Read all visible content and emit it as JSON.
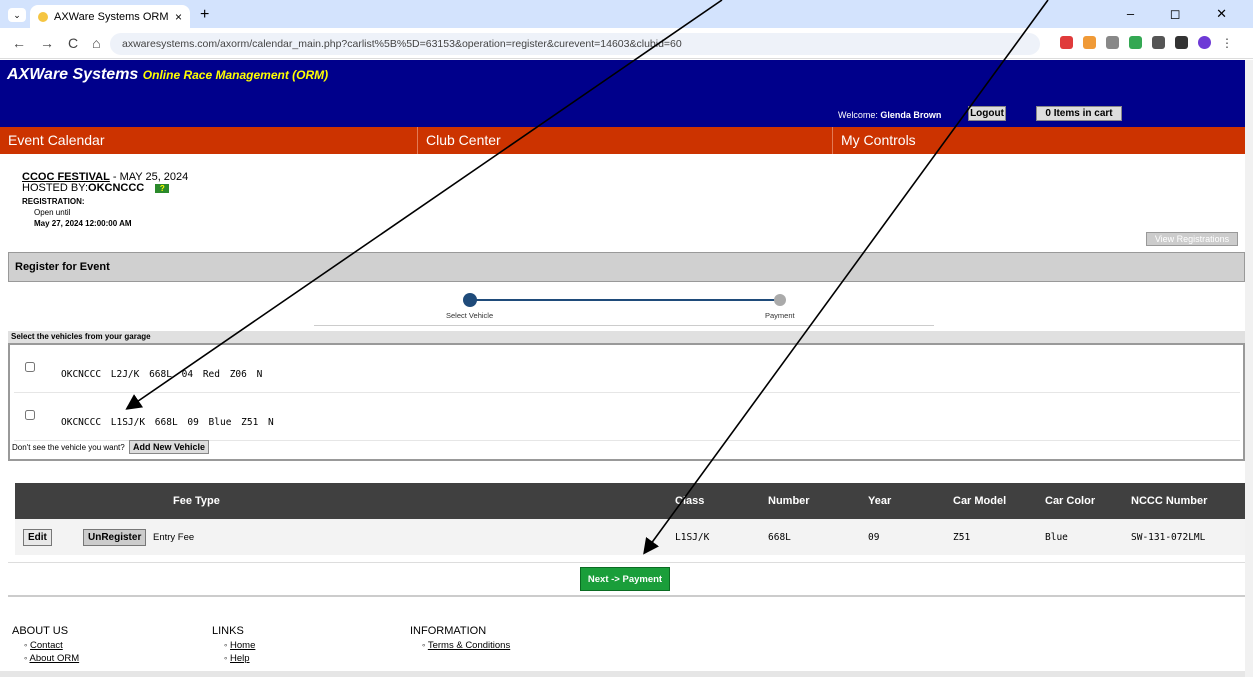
{
  "browser": {
    "tab_title": "AXWare Systems ORM",
    "new_tab": "+",
    "tab_close": "×",
    "tab_menu": "⌄",
    "window_controls": "–  ◻  ✕",
    "back": "←",
    "forward": "→",
    "reload": "C",
    "home": "⌂",
    "url": "axwaresystems.com/axorm/calendar_main.php?carlist%5B%5D=63153&operation=register&curevent=14603&clubid=60"
  },
  "header": {
    "brand": "AXWare Systems",
    "brand_sub": "Online Race Management (ORM)",
    "welcome_prefix": "Welcome:",
    "user_name": "Glenda Brown",
    "logout": "Logout",
    "cart": "0 Items in cart"
  },
  "menu": {
    "event_calendar": "Event Calendar",
    "club_center": "Club Center",
    "my_controls": "My Controls"
  },
  "event": {
    "name": "CCOC FESTIVAL",
    "date": "- MAY 25, 2024",
    "hosted_by_label": "HOSTED BY:",
    "host": "OKCNCCC",
    "help_badge": "?",
    "registration_label": "REGISTRATION:",
    "open_until_label": "Open until",
    "open_until": "May 27, 2024 12:00:00 AM",
    "view_registrations": "View Registrations"
  },
  "register": {
    "title": "Register for Event",
    "step1": "Select Vehicle",
    "step2": "Payment",
    "garage_header": "Select the vehicles from your garage",
    "vehicles": [
      {
        "text": "OKCNCCC  L2J/K   668L  04  Red  Z06  N"
      },
      {
        "text": "OKCNCCC  L1SJ/K   668L  09  Blue  Z51  N"
      }
    ],
    "dont_see": "Don't see the vehicle you want?",
    "add_vehicle": "Add New Vehicle"
  },
  "fees": {
    "headers": [
      "Fee Type",
      "Class",
      "Number",
      "Year",
      "Car Model",
      "Car Color",
      "NCCC Number"
    ],
    "row": {
      "edit": "Edit",
      "unregister": "UnRegister",
      "fee_type": "Entry Fee",
      "class": "L1SJ/K",
      "number": "668L",
      "year": "09",
      "car_model": "Z51",
      "car_color": "Blue",
      "nccc_number": "SW-131-072LML"
    },
    "next_button": "Next -> Payment"
  },
  "footer": {
    "about_title": "ABOUT US",
    "about_links": [
      "Contact",
      "About ORM"
    ],
    "links_title": "LINKS",
    "links": [
      "Home",
      "Help"
    ],
    "info_title": "INFORMATION",
    "info_links": [
      "Terms & Conditions"
    ]
  },
  "colors": {
    "brand_blue": "#00008b",
    "menu_orange": "#cc3300",
    "next_green": "#1a9e3a"
  }
}
